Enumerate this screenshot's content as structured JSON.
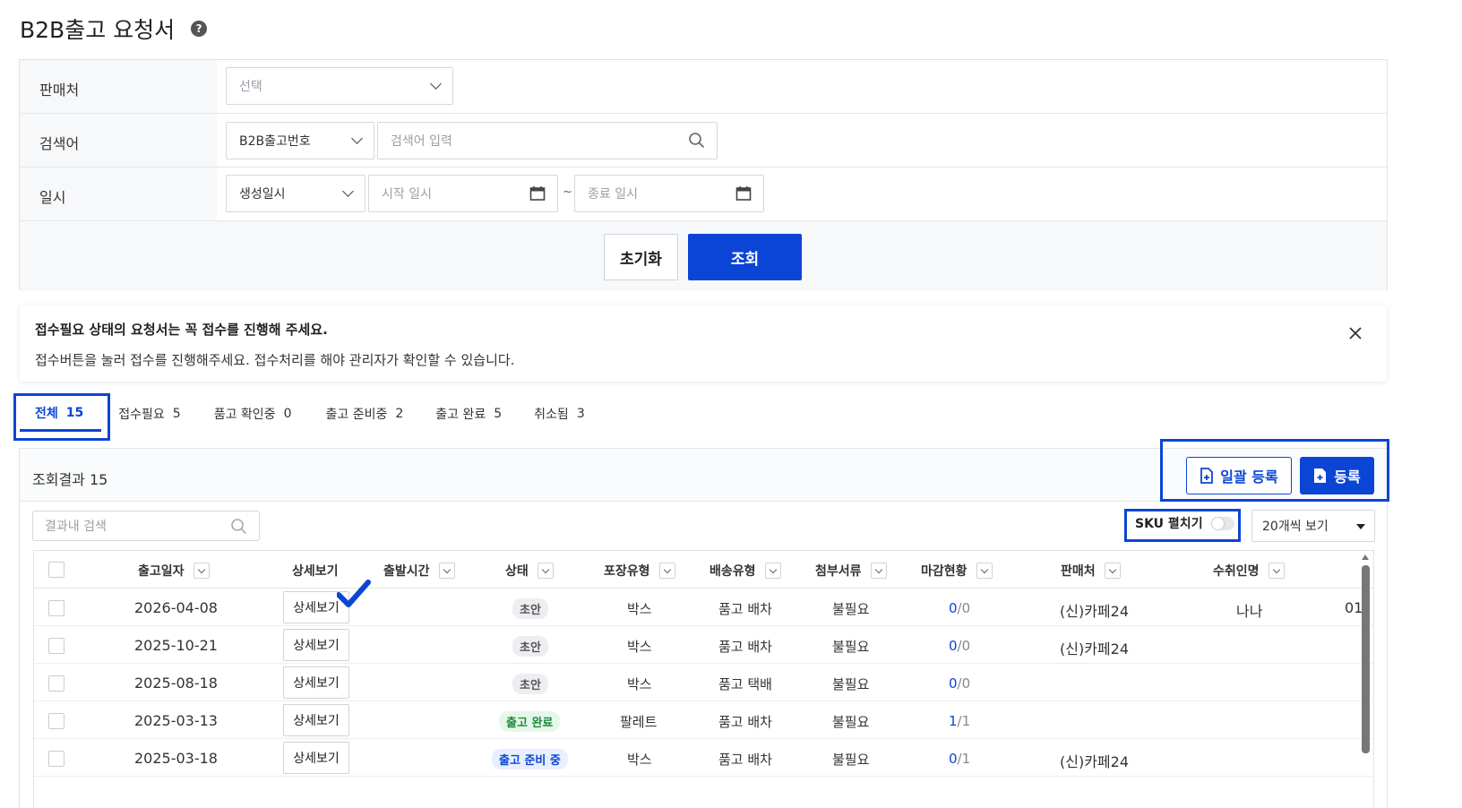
{
  "page": {
    "title": "B2B출고 요청서",
    "help_icon": "?"
  },
  "filters": {
    "seller_label": "판매처",
    "seller_placeholder": "선택",
    "keyword_label": "검색어",
    "keyword_type": "B2B출고번호",
    "keyword_placeholder": "검색어 입력",
    "date_label": "일시",
    "date_type": "생성일시",
    "start_placeholder": "시작 일시",
    "tilde": "~",
    "end_placeholder": "종료 일시",
    "reset_label": "초기화",
    "search_label": "조회"
  },
  "notice": {
    "title": "접수필요 상태의 요청서는 꼭 접수를 진행해 주세요.",
    "body": "접수버튼을 눌러 접수를 진행해주세요. 접수처리를 해야 관리자가 확인할 수 있습니다."
  },
  "tabs": [
    {
      "label": "전체",
      "count": "15"
    },
    {
      "label": "접수필요",
      "count": "5"
    },
    {
      "label": "품고 확인중",
      "count": "0"
    },
    {
      "label": "출고 준비중",
      "count": "2"
    },
    {
      "label": "출고 완료",
      "count": "5"
    },
    {
      "label": "취소됨",
      "count": "3"
    }
  ],
  "results": {
    "count_label": "조회결과 15",
    "bulk_register": "일괄 등록",
    "register": "등록",
    "search_placeholder": "결과내 검색",
    "sku_toggle": "SKU 펼치기",
    "per_page": "20개씩 보기"
  },
  "table": {
    "headers": {
      "date": "출고일자",
      "detail": "상세보기",
      "depart": "출발시간",
      "status": "상태",
      "pack": "포장유형",
      "ship": "배송유형",
      "docs": "첨부서류",
      "close": "마감현황",
      "seller": "판매처",
      "receiver": "수취인명"
    },
    "rows": [
      {
        "date": "2026-04-08",
        "detail": "상세보기",
        "status": "초안",
        "pack": "박스",
        "ship": "품고 배차",
        "docs": "불필요",
        "done": "0",
        "total": "/0",
        "seller": "(신)카페24",
        "receiver": "나나",
        "extra": "01"
      },
      {
        "date": "2025-10-21",
        "detail": "상세보기",
        "status": "초안",
        "pack": "박스",
        "ship": "품고 배차",
        "docs": "불필요",
        "done": "0",
        "total": "/0",
        "seller": "(신)카페24",
        "receiver": "",
        "extra": ""
      },
      {
        "date": "2025-08-18",
        "detail": "상세보기",
        "status": "초안",
        "pack": "박스",
        "ship": "품고 택배",
        "docs": "불필요",
        "done": "0",
        "total": "/0",
        "seller": "",
        "receiver": "",
        "extra": ""
      },
      {
        "date": "2025-03-13",
        "detail": "상세보기",
        "status": "출고 완료",
        "pack": "팔레트",
        "ship": "품고 배차",
        "docs": "불필요",
        "done": "1",
        "total": "/1",
        "seller": "",
        "receiver": "",
        "extra": ""
      },
      {
        "date": "2025-03-18",
        "detail": "상세보기",
        "status": "출고 준비 중",
        "pack": "박스",
        "ship": "품고 배차",
        "docs": "불필요",
        "done": "0",
        "total": "/1",
        "seller": "(신)카페24",
        "receiver": "",
        "extra": ""
      }
    ]
  },
  "colors": {
    "primary": "#0b45d6",
    "success": "#1b8a3a"
  }
}
